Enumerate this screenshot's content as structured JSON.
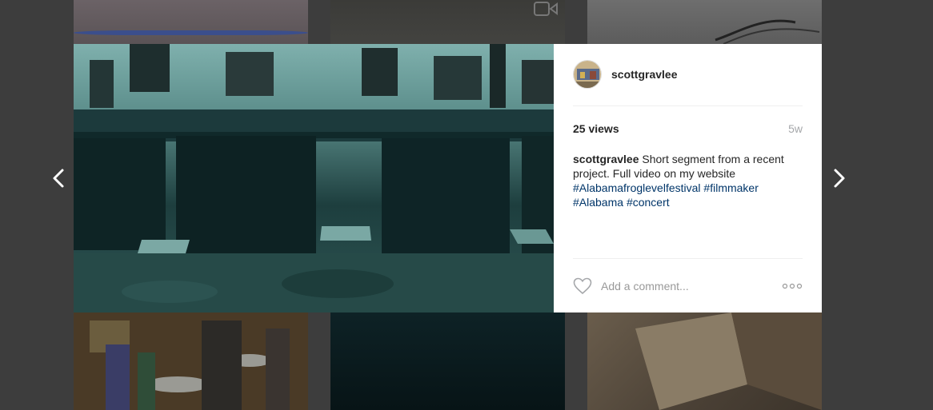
{
  "post": {
    "username": "scottgravlee",
    "views": "25 views",
    "age": "5w",
    "caption": {
      "username": "scottgravlee",
      "text": " Short segment from a recent project. Full video on my website ",
      "hashtags": [
        "#Alabamafroglevelfestival",
        "#filmmaker",
        "#Alabama",
        "#concert"
      ]
    },
    "comment_placeholder": "Add a comment..."
  },
  "icons": {
    "prev": "chevron-left-icon",
    "next": "chevron-right-icon",
    "like": "heart-icon",
    "more": "more-options-icon",
    "video": "video-camera-icon"
  },
  "colors": {
    "backdrop": "#3d3d3d",
    "link": "#003569",
    "muted": "#a5a7aa"
  }
}
